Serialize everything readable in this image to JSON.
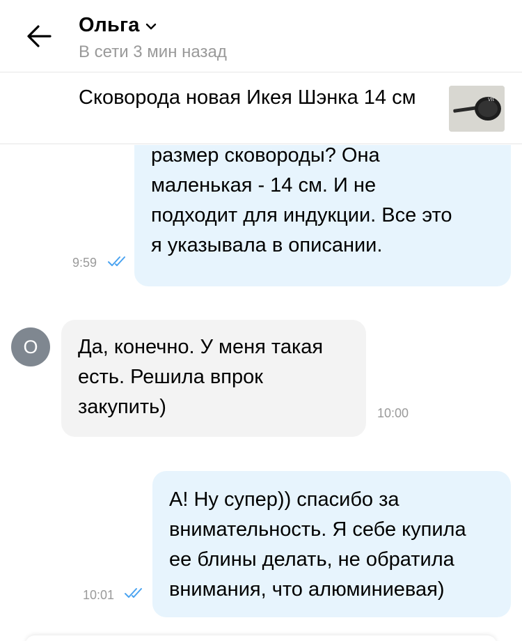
{
  "header": {
    "contact_name": "Ольга",
    "status": "В сети 3 мин назад"
  },
  "listing": {
    "title": "Сковорода новая Икея Шэнка 14 см",
    "thumbnail_icon": "frying-pan-photo"
  },
  "messages": [
    {
      "direction": "out",
      "lines": [
        "размер сковороды? Она",
        "маленькая - 14 см. И не",
        "подходит для индукции. Все это",
        "я указывала в описании."
      ],
      "time": "9:59",
      "read": true
    },
    {
      "direction": "in",
      "avatar_letter": "О",
      "lines": [
        "Да, конечно. У меня такая",
        "есть. Решила впрок",
        "закупить)"
      ],
      "time": "10:00"
    },
    {
      "direction": "out",
      "lines": [
        "А! Ну супер)) спасибо за",
        "внимательность. Я себе купила",
        "ее блины делать, не обратила",
        "внимания, что алюминиевая)"
      ],
      "time": "10:01",
      "read": true
    }
  ],
  "colors": {
    "outgoing_bubble": "#e7f4fd",
    "incoming_bubble": "#f3f3f3",
    "read_check": "#4aa3f0",
    "avatar_bg": "#7f8790"
  }
}
